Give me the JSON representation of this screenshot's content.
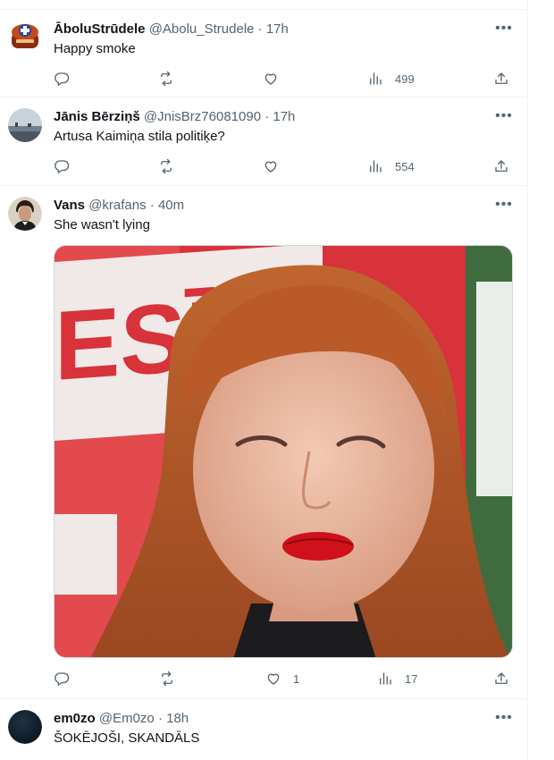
{
  "tweets": [
    {
      "name": "ĀboluStrūdele",
      "handle": "@Abolu_Strudele",
      "time": "17h",
      "text": "Happy smoke",
      "views": "499"
    },
    {
      "name": "Jānis Bērziņš",
      "handle": "@JnisBrz76081090",
      "time": "17h",
      "text": "Artusa Kaimiņa stila politiķe?",
      "views": "554"
    },
    {
      "name": "Vans",
      "handle": "@krafans",
      "time": "40m",
      "text": "She wasn't lying",
      "likes": "1",
      "views": "17",
      "media_overlay_text": "ESĪV"
    },
    {
      "name": "em0zo",
      "handle": "@Em0zo",
      "time": "18h",
      "text": "ŠOKĒJOŠI, SKANDĀLS"
    }
  ],
  "separator": "·",
  "more_label": "•••",
  "icons": {
    "reply": "reply-icon",
    "retweet": "retweet-icon",
    "like": "heart-icon",
    "views": "views-icon",
    "share": "share-icon",
    "more": "more-icon"
  },
  "colors": {
    "text": "#0f1419",
    "secondary": "#536471",
    "border": "#eff3f4"
  }
}
